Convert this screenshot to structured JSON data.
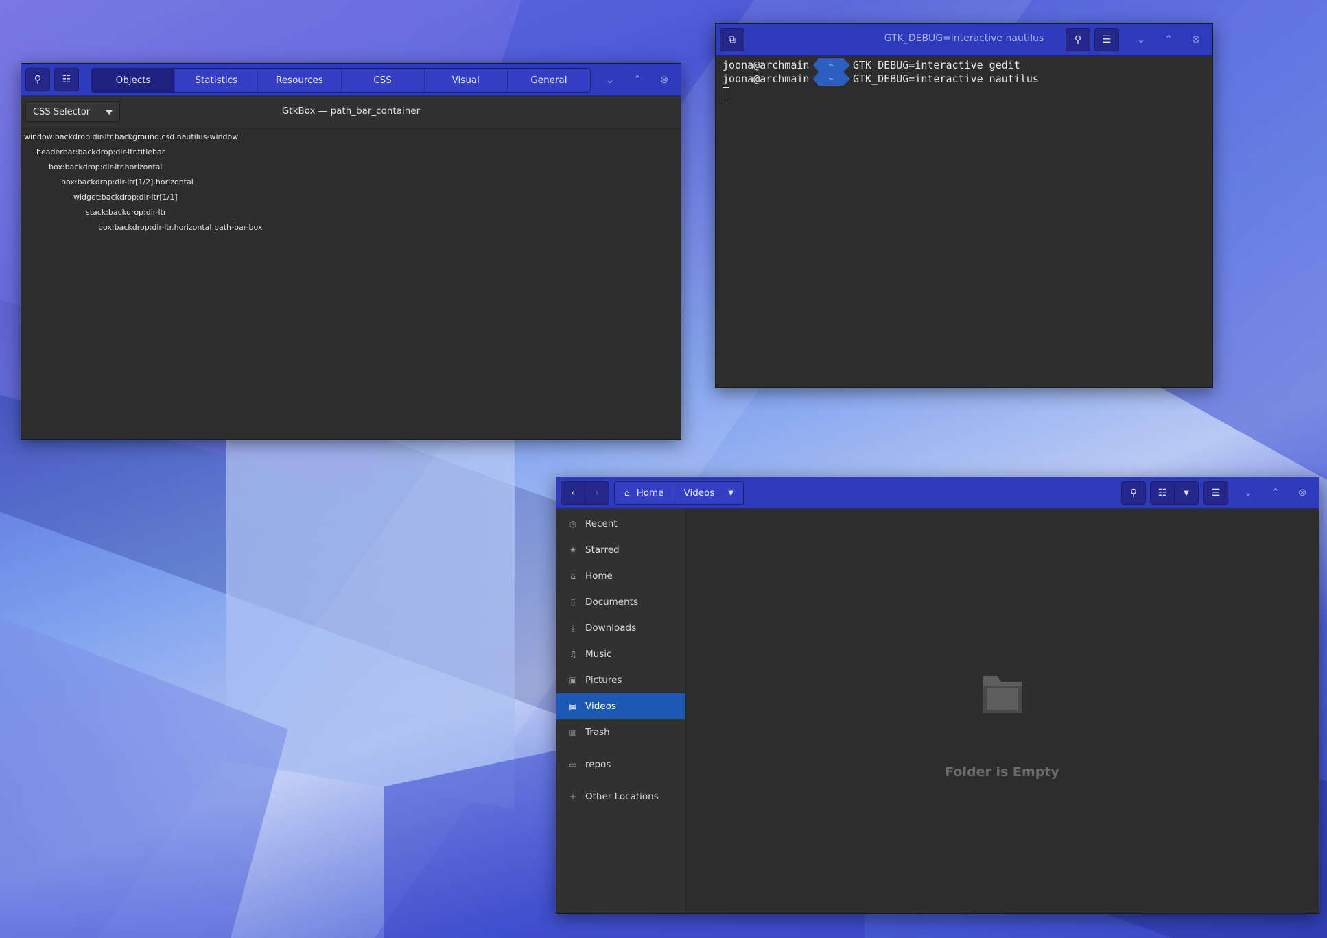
{
  "inspector": {
    "tabs": [
      "Objects",
      "Statistics",
      "Resources",
      "CSS",
      "Visual",
      "General"
    ],
    "active_tab": "Objects",
    "selector_label": "CSS Selector",
    "object_title": "GtkBox — path_bar_container",
    "tree": [
      "window:backdrop:dir-ltr.background.csd.nautilus-window",
      "headerbar:backdrop:dir-ltr.titlebar",
      "box:backdrop:dir-ltr.horizontal",
      "box:backdrop:dir-ltr[1/2].horizontal",
      "widget:backdrop:dir-ltr[1/1]",
      "stack:backdrop:dir-ltr",
      "box:backdrop:dir-ltr.horizontal.path-bar-box"
    ]
  },
  "terminal": {
    "title": "GTK_DEBUG=interactive nautilus",
    "path_marker": "~",
    "lines": [
      {
        "user": "joona@archmain",
        "cmd": "GTK_DEBUG=interactive gedit"
      },
      {
        "user": "joona@archmain",
        "cmd": "GTK_DEBUG=interactive nautilus"
      }
    ]
  },
  "files": {
    "breadcrumbs": [
      "Home",
      "Videos"
    ],
    "sidebar": [
      {
        "label": "Recent",
        "icon": "clock-icon"
      },
      {
        "label": "Starred",
        "icon": "star-icon"
      },
      {
        "label": "Home",
        "icon": "home-icon"
      },
      {
        "label": "Documents",
        "icon": "document-icon"
      },
      {
        "label": "Downloads",
        "icon": "download-icon"
      },
      {
        "label": "Music",
        "icon": "music-icon"
      },
      {
        "label": "Pictures",
        "icon": "picture-icon"
      },
      {
        "label": "Videos",
        "icon": "film-icon",
        "selected": true
      },
      {
        "label": "Trash",
        "icon": "trash-icon"
      },
      {
        "label": "repos",
        "icon": "folder-icon"
      },
      {
        "label": "Other Locations",
        "icon": "plus-icon"
      }
    ],
    "empty_message": "Folder is Empty"
  },
  "colors": {
    "headerbar": "#2e3bbd",
    "selection": "#1c58b4",
    "window_bg": "#2d2d2d"
  }
}
